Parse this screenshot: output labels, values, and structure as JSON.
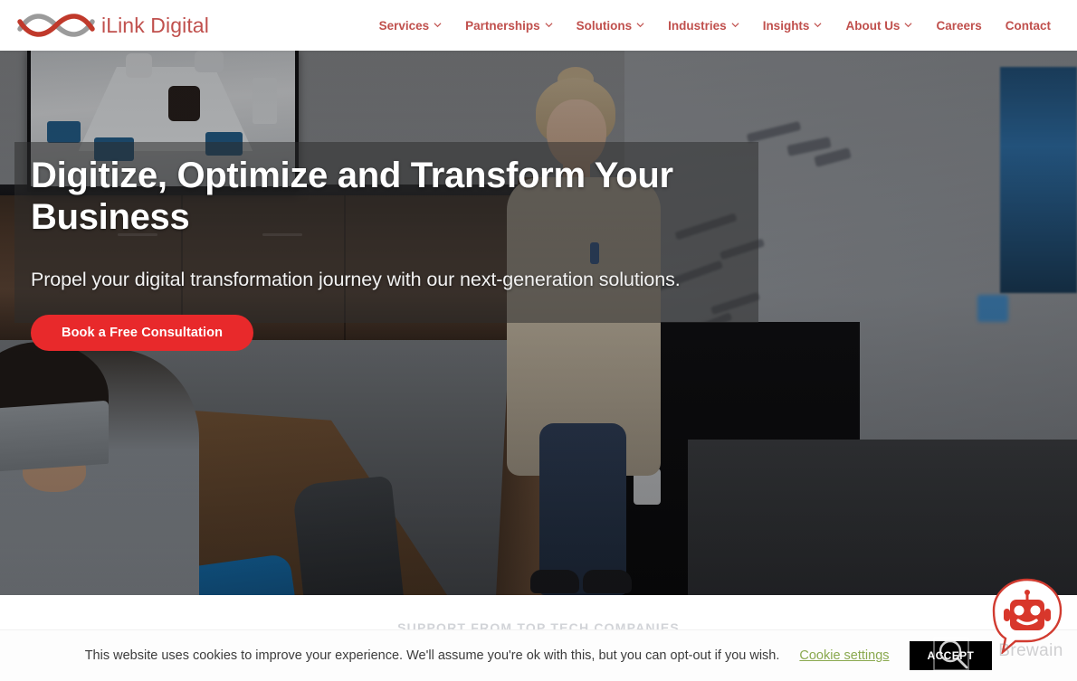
{
  "header": {
    "logo_icon": "ilink-infinity-logo",
    "brand_name": "iLink Digital",
    "nav": [
      {
        "label": "Services",
        "has_dropdown": true,
        "icon": "chevron-down-icon"
      },
      {
        "label": "Partnerships",
        "has_dropdown": true,
        "icon": "chevron-down-icon"
      },
      {
        "label": "Solutions",
        "has_dropdown": true,
        "icon": "chevron-down-icon"
      },
      {
        "label": "Industries",
        "has_dropdown": true,
        "icon": "chevron-down-icon"
      },
      {
        "label": "Insights",
        "has_dropdown": true,
        "icon": "chevron-down-icon"
      },
      {
        "label": "About Us",
        "has_dropdown": true,
        "icon": "chevron-down-icon"
      },
      {
        "label": "Careers",
        "has_dropdown": false,
        "icon": ""
      },
      {
        "label": "Contact",
        "has_dropdown": false,
        "icon": ""
      }
    ]
  },
  "hero": {
    "title": "Digitize, Optimize and Transform Your Business",
    "subtitle": "Propel your digital transformation journey with our next-generation solutions.",
    "cta_label": "Book a Free Consultation"
  },
  "support_section": {
    "title": "SUPPORT FROM TOP TECH COMPANIES"
  },
  "cookie_banner": {
    "message": "This website uses cookies to improve your experience. We'll assume you're ok with this, but you can opt-out if you wish.",
    "settings_label": "Cookie settings",
    "accept_label": "ACCEPT"
  },
  "chat_widget": {
    "icon": "robot-chat-icon",
    "label": "Brewain"
  },
  "colors": {
    "brand_red": "#c0504d",
    "cta_red": "#e8292b",
    "cookie_link_green": "#8aa94f",
    "accept_black": "#000000",
    "support_gray": "#d2d4d8"
  }
}
